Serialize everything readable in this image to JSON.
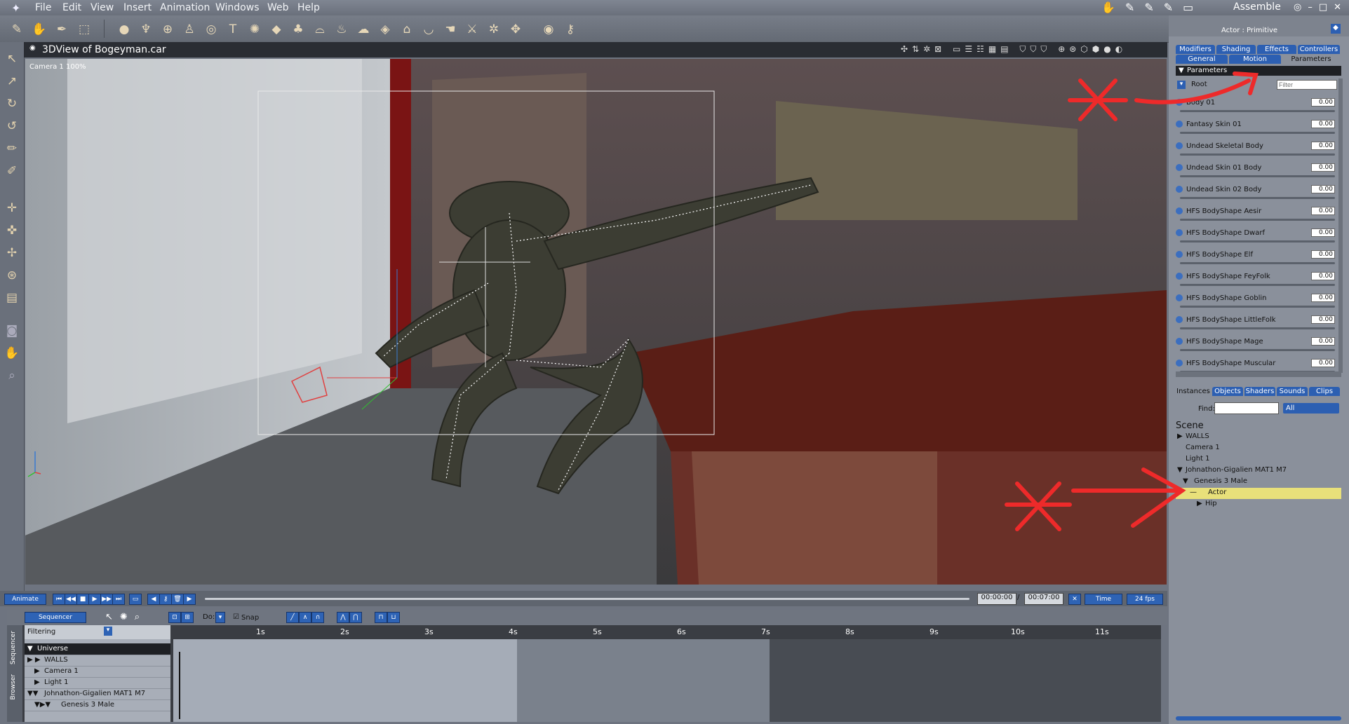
{
  "menubar": {
    "items": [
      "File",
      "Edit",
      "View",
      "Insert",
      "Animation",
      "Windows",
      "Web",
      "Help"
    ],
    "room": "Assemble"
  },
  "viewport": {
    "title": "3DView of Bogeyman.car",
    "camera_label": "Camera 1 100%"
  },
  "transport": {
    "animate_label": "Animate",
    "current_time": "00:00:00",
    "end_time": "00:07:00",
    "time_mode": "Time",
    "fps": "24 fps"
  },
  "sequencer": {
    "mode": "Sequencer",
    "filtering": "Filtering",
    "do_label": "Do:",
    "snap_label": "Snap",
    "side_tabs": [
      "Sequencer",
      "Browser"
    ],
    "ruler": [
      "1s",
      "2s",
      "3s",
      "4s",
      "5s",
      "6s",
      "7s",
      "8s",
      "9s",
      "10s",
      "11s"
    ],
    "tracks": [
      "Universe",
      "WALLS",
      "Camera 1",
      "Light 1",
      "Johnathon-Gigalien MAT1 M7",
      "Genesis 3 Male"
    ]
  },
  "right_panel": {
    "header": "Actor : Primitive",
    "tabs_top": [
      "Modifiers",
      "Shading",
      "Effects",
      "Controllers"
    ],
    "tabs_second": [
      "General",
      "Motion",
      "Parameters"
    ],
    "section": "Parameters",
    "root_label": "Root",
    "filter_placeholder": "Filter",
    "params": [
      {
        "label": "Body 01",
        "value": "0.00"
      },
      {
        "label": "Fantasy Skin 01",
        "value": "0.00"
      },
      {
        "label": "Undead Skeletal Body",
        "value": "0.00"
      },
      {
        "label": "Undead Skin 01 Body",
        "value": "0.00"
      },
      {
        "label": "Undead Skin 02 Body",
        "value": "0.00"
      },
      {
        "label": "HFS BodyShape Aesir",
        "value": "0.00"
      },
      {
        "label": "HFS BodyShape Dwarf",
        "value": "0.00"
      },
      {
        "label": "HFS BodyShape Elf",
        "value": "0.00"
      },
      {
        "label": "HFS BodyShape FeyFolk",
        "value": "0.00"
      },
      {
        "label": "HFS BodyShape Goblin",
        "value": "0.00"
      },
      {
        "label": "HFS BodyShape LittleFolk",
        "value": "0.00"
      },
      {
        "label": "HFS BodyShape Mage",
        "value": "0.00"
      },
      {
        "label": "HFS BodyShape Muscular",
        "value": "0.00"
      }
    ],
    "tabs_bottom": [
      "Instances",
      "Objects",
      "Shaders",
      "Sounds",
      "Clips"
    ],
    "find_label": "Find:",
    "find_filter": "All",
    "scene_title": "Scene",
    "scene_items": [
      "WALLS",
      "Camera 1",
      "Light 1",
      "Johnathon-Gigalien MAT1 M7",
      "Genesis 3 Male",
      "Actor",
      "Hip"
    ]
  },
  "colors": {
    "selection": "#e8e07a",
    "annotation": "#ee2a2a",
    "tab_blue": "#2c5fb2"
  }
}
